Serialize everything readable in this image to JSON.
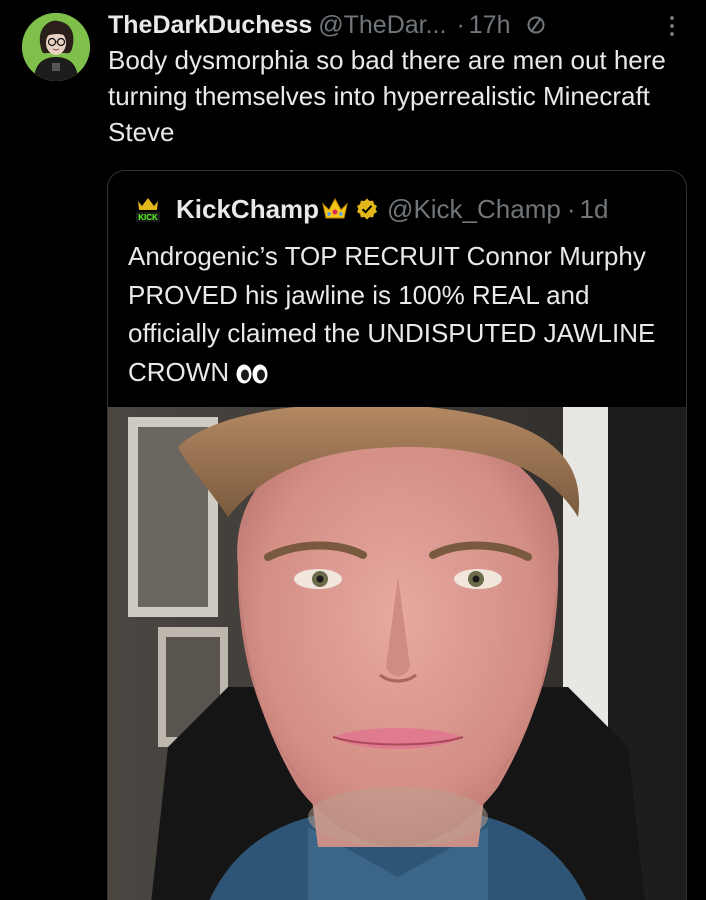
{
  "post": {
    "author": {
      "display_name": "TheDarkDuchess",
      "handle": "@TheDar...",
      "avatar": "avatar-illustration"
    },
    "dot": "·",
    "time": "17h",
    "edited_icon": "no-symbol-icon",
    "more_icon": "more-dots-icon",
    "text": "Body dysmorphia so bad there are men out here turning themselves into hyperrealistic Minecraft Steve"
  },
  "quoted_post": {
    "author": {
      "display_name": "KickChamp",
      "handle": "@Kick_Champ",
      "avatar_text": "KICK",
      "badge": "verified-badge-icon",
      "emoji": "crown-icon"
    },
    "dot": "·",
    "time": "1d",
    "text": "Androgenic’s TOP RECRUIT Connor Murphy PROVED his jawline is 100% REAL and officially claimed the UNDISPUTED JAWLINE CROWN",
    "trailing_emoji": "eyes-icon",
    "media": "video-thumbnail-face"
  },
  "colors": {
    "background": "#000000",
    "primary_text": "#e7e9ea",
    "secondary_text": "#71767b",
    "border": "#2f3336",
    "verified_gold": "#e2b719",
    "avatar_green": "#7fc04a"
  }
}
